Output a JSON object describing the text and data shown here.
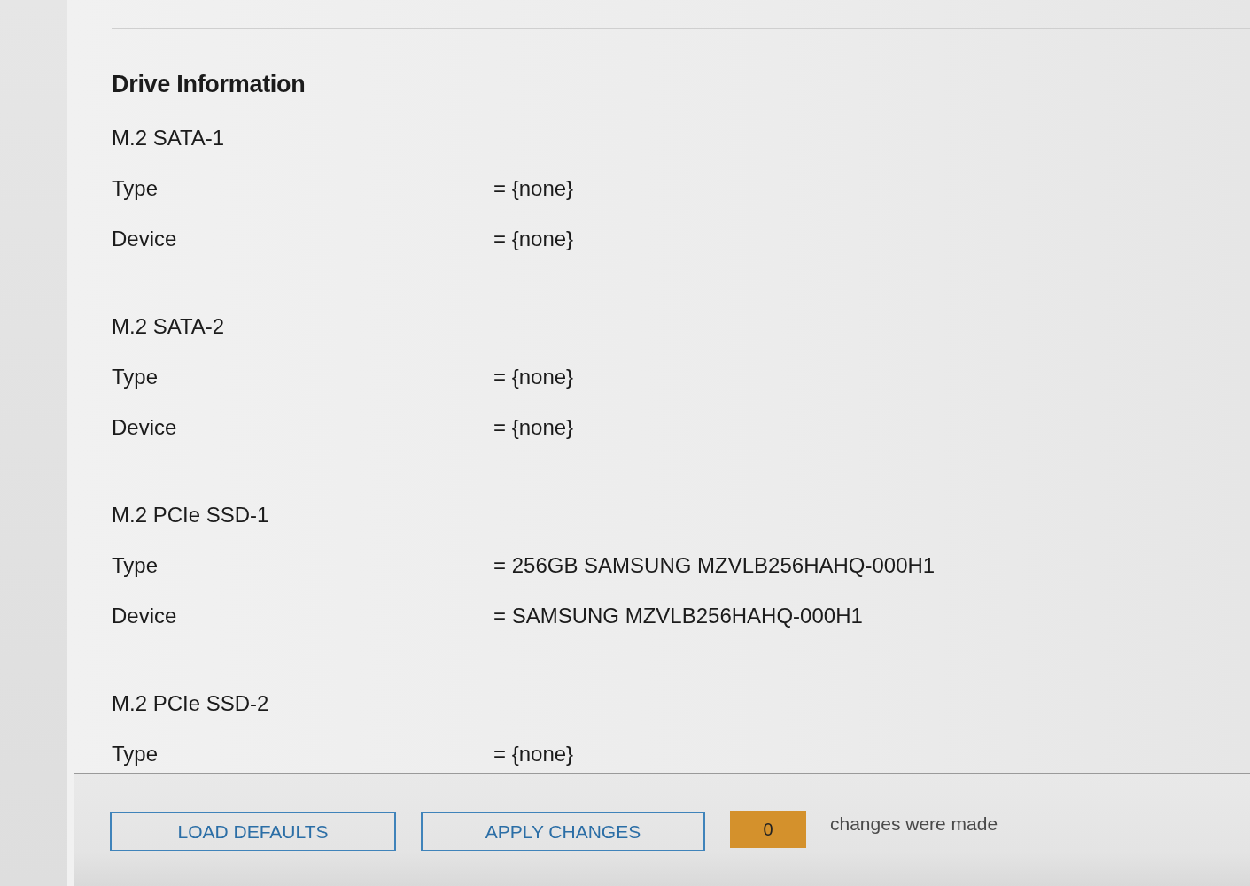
{
  "section": {
    "title": "Drive Information",
    "groups": [
      {
        "title": "M.2 SATA-1",
        "rows": [
          {
            "label": "Type",
            "value": "= {none}"
          },
          {
            "label": "Device",
            "value": "= {none}"
          }
        ]
      },
      {
        "title": "M.2 SATA-2",
        "rows": [
          {
            "label": "Type",
            "value": "= {none}"
          },
          {
            "label": "Device",
            "value": "= {none}"
          }
        ]
      },
      {
        "title": "M.2 PCIe SSD-1",
        "rows": [
          {
            "label": "Type",
            "value": "= 256GB SAMSUNG MZVLB256HAHQ-000H1"
          },
          {
            "label": "Device",
            "value": "= SAMSUNG MZVLB256HAHQ-000H1"
          }
        ]
      },
      {
        "title": "M.2 PCIe SSD-2",
        "rows": [
          {
            "label": "Type",
            "value": "= {none}"
          }
        ]
      }
    ]
  },
  "footer": {
    "buttons": [
      {
        "label": "LOAD DEFAULTS"
      },
      {
        "label": "APPLY CHANGES"
      }
    ],
    "change_count": "0",
    "change_note": "changes were made"
  }
}
